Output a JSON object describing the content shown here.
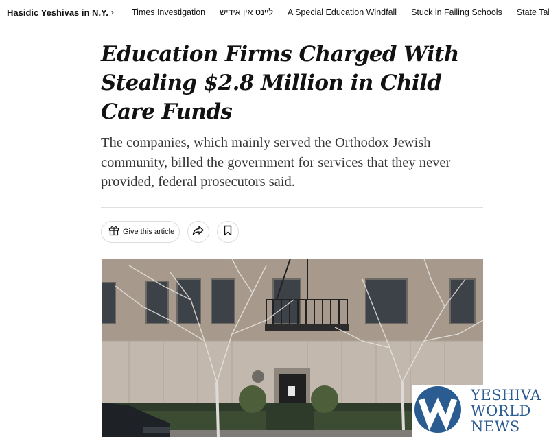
{
  "nav": {
    "section": "Hasidic Yeshivas in N.Y.",
    "links": [
      "Times Investigation",
      "ליינט אין אידיש",
      "A Special Education Windfall",
      "Stuck in Failing Schools",
      "State Takes"
    ]
  },
  "article": {
    "headline": "Education Firms Charged With Stealing $2.8 Million in Child Care Funds",
    "summary": "The companies, which mainly served the Orthodox Jewish community, billed the government for services that they never provided, federal prosecutors said."
  },
  "share": {
    "gift_label": "Give this article",
    "icons": [
      "gift-icon",
      "share-icon",
      "bookmark-icon"
    ]
  },
  "photo": {
    "subject": "building-with-fire-escape-and-bare-trees"
  },
  "watermark": {
    "line1": "YESHIVA",
    "line2": "WORLD",
    "line3": "NEWS",
    "color": "#2b5c91"
  }
}
